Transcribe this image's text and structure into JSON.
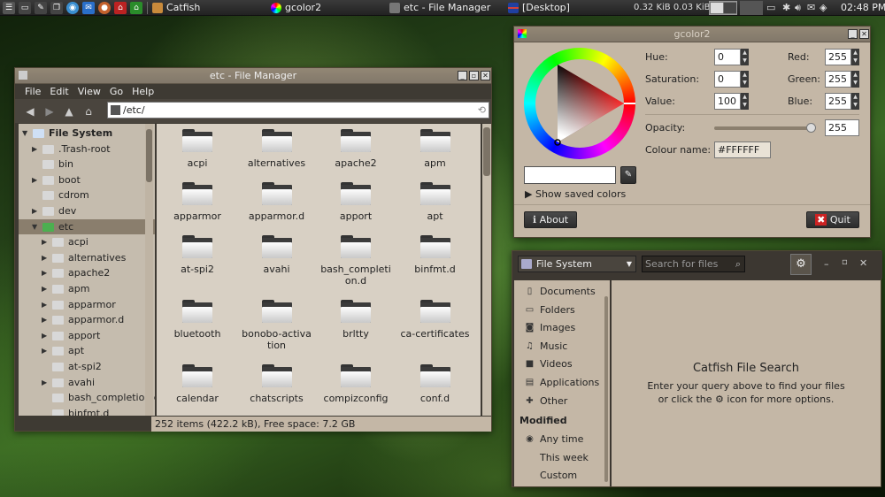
{
  "panel": {
    "taskbar_items": [
      {
        "label": "Catfish",
        "icon": "magnifier-icon",
        "color": "#c98a3b"
      },
      {
        "label": "gcolor2",
        "icon": "color-wheel-icon",
        "color": "#a24bd1"
      },
      {
        "label": "etc - File Manager",
        "icon": "folder-icon",
        "color": "#777777"
      },
      {
        "label": "[Desktop]",
        "icon": "flag-icon",
        "color": "#d0403a"
      }
    ],
    "net_speed": "0.32 KiB 0.03 KiB",
    "clock": "02:48 PM"
  },
  "file_manager": {
    "title": "etc - File Manager",
    "menu": [
      "File",
      "Edit",
      "View",
      "Go",
      "Help"
    ],
    "location": "/etc/",
    "tree": [
      {
        "label": "File System",
        "expander": "▼",
        "indent": 0,
        "bold": true
      },
      {
        "label": ".Trash-root",
        "expander": "▶",
        "indent": 1
      },
      {
        "label": "bin",
        "expander": "",
        "indent": 1
      },
      {
        "label": "boot",
        "expander": "▶",
        "indent": 1
      },
      {
        "label": "cdrom",
        "expander": "",
        "indent": 1
      },
      {
        "label": "dev",
        "expander": "▶",
        "indent": 1
      },
      {
        "label": "etc",
        "expander": "▼",
        "indent": 1,
        "selected": true
      },
      {
        "label": "acpi",
        "expander": "▶",
        "indent": 2
      },
      {
        "label": "alternatives",
        "expander": "▶",
        "indent": 2
      },
      {
        "label": "apache2",
        "expander": "▶",
        "indent": 2
      },
      {
        "label": "apm",
        "expander": "▶",
        "indent": 2
      },
      {
        "label": "apparmor",
        "expander": "▶",
        "indent": 2
      },
      {
        "label": "apparmor.d",
        "expander": "▶",
        "indent": 2
      },
      {
        "label": "apport",
        "expander": "▶",
        "indent": 2
      },
      {
        "label": "apt",
        "expander": "▶",
        "indent": 2
      },
      {
        "label": "at-spi2",
        "expander": "",
        "indent": 2
      },
      {
        "label": "avahi",
        "expander": "▶",
        "indent": 2
      },
      {
        "label": "bash_completion.d",
        "expander": "",
        "indent": 2
      },
      {
        "label": "binfmt.d",
        "expander": "",
        "indent": 2
      }
    ],
    "folders": [
      "acpi",
      "alternatives",
      "apache2",
      "apm",
      "apparmor",
      "apparmor.d",
      "apport",
      "apt",
      "at-spi2",
      "avahi",
      "bash_completion.d",
      "binfmt.d",
      "bluetooth",
      "bonobo-activation",
      "brltty",
      "ca-certificates",
      "calendar",
      "chatscripts",
      "compizconfig",
      "conf.d"
    ],
    "status": "252 items (422.2 kB), Free space: 7.2 GB"
  },
  "gcolor2": {
    "title": "gcolor2",
    "hue_label": "Hue:",
    "hue": "0",
    "sat_label": "Saturation:",
    "sat": "0",
    "val_label": "Value:",
    "val": "100",
    "red_label": "Red:",
    "red": "255",
    "green_label": "Green:",
    "green": "255",
    "blue_label": "Blue:",
    "blue": "255",
    "opacity_label": "Opacity:",
    "opacity": "255",
    "colour_name_label": "Colour name:",
    "colour_name": "#FFFFFF",
    "show_saved": "Show saved colors",
    "about": "About",
    "quit": "Quit",
    "current_color": "#FFFFFF"
  },
  "catfish": {
    "location": "File System",
    "search_placeholder": "Search for files",
    "places": [
      {
        "label": "Documents",
        "icon": "document-icon",
        "glyph": "▯"
      },
      {
        "label": "Folders",
        "icon": "folder-icon",
        "glyph": "▭"
      },
      {
        "label": "Images",
        "icon": "camera-icon",
        "glyph": "◙"
      },
      {
        "label": "Music",
        "icon": "music-note-icon",
        "glyph": "♫"
      },
      {
        "label": "Videos",
        "icon": "video-camera-icon",
        "glyph": "■"
      },
      {
        "label": "Applications",
        "icon": "applications-icon",
        "glyph": "▤"
      },
      {
        "label": "Other",
        "icon": "puzzle-icon",
        "glyph": "✚"
      }
    ],
    "modified_label": "Modified",
    "modified": [
      {
        "label": "Any time",
        "selected": true
      },
      {
        "label": "This week",
        "selected": false
      },
      {
        "label": "Custom",
        "selected": false
      }
    ],
    "heading": "Catfish File Search",
    "hint_line1": "Enter your query above to find your files",
    "hint_line2_a": "or click the",
    "hint_line2_b": "icon for more options."
  }
}
